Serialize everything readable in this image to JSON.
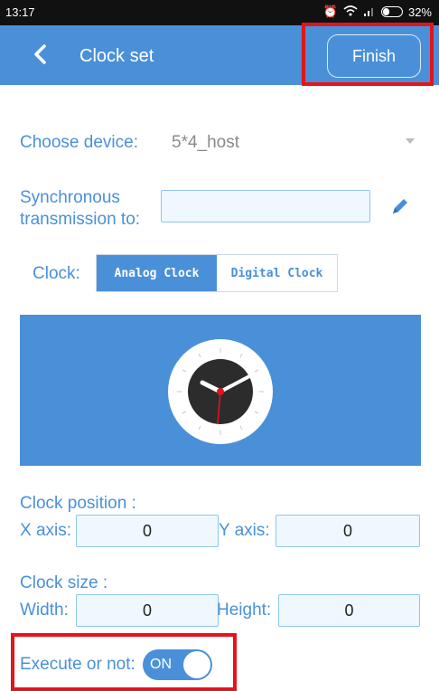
{
  "status_bar": {
    "time": "13:17",
    "battery": "32%"
  },
  "header": {
    "title": "Clock set",
    "finish_label": "Finish"
  },
  "device": {
    "label": "Choose device:",
    "value": "5*4_host"
  },
  "sync": {
    "label_line1": "Synchronous",
    "label_line2": "transmission to:",
    "value": ""
  },
  "clock": {
    "label": "Clock:",
    "options": [
      "Analog Clock",
      "Digital Clock"
    ],
    "selected": "Analog Clock"
  },
  "position": {
    "title": "Clock position :",
    "x_label": "X axis:",
    "x_value": "0",
    "y_label": "Y axis:",
    "y_value": "0"
  },
  "size": {
    "title": "Clock size :",
    "width_label": "Width:",
    "width_value": "0",
    "height_label": "Height:",
    "height_value": "0"
  },
  "execute": {
    "label": "Execute or not:",
    "toggle_text": "ON",
    "state": true
  },
  "colors": {
    "accent": "#4a90d9",
    "highlight": "#e3141c"
  }
}
